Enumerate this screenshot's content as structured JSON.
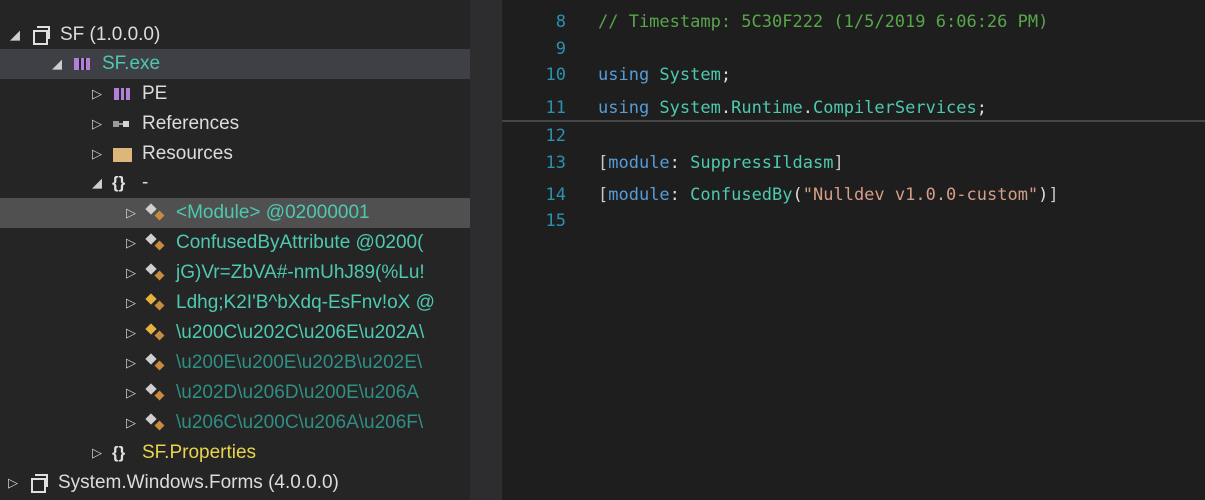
{
  "tree": {
    "nodes": [
      {
        "arrow": "◢",
        "icon": "assembly-icon",
        "label": "SF (1.0.0.0)"
      },
      {
        "arrow": "◢",
        "icon": "exe-icon",
        "label": "SF.exe"
      },
      {
        "arrow": "▷",
        "icon": "exe-icon",
        "label": "PE"
      },
      {
        "arrow": "▷",
        "icon": "references-icon",
        "label": "References"
      },
      {
        "arrow": "▷",
        "icon": "folder-icon",
        "label": "Resources"
      },
      {
        "arrow": "◢",
        "icon": "namespace-icon",
        "label": "-"
      },
      {
        "arrow": "▷",
        "icon": "type-icon",
        "label": "<Module> @02000001"
      },
      {
        "arrow": "▷",
        "icon": "type-icon",
        "label": "ConfusedByAttribute @0200("
      },
      {
        "arrow": "▷",
        "icon": "type-icon",
        "label": "jG)Vr=ZbVA#-nmUhJ89(%Lu!"
      },
      {
        "arrow": "▷",
        "icon": "type-icon",
        "label": "Ldhg;K2I'B^bXdq-EsFnv!oX @"
      },
      {
        "arrow": "▷",
        "icon": "type-icon",
        "label": "\\u200C\\u202C\\u206E\\u202A\\"
      },
      {
        "arrow": "▷",
        "icon": "type-icon",
        "label": "\\u200E\\u200E\\u202B\\u202E\\"
      },
      {
        "arrow": "▷",
        "icon": "type-icon",
        "label": "\\u202D\\u206D\\u200E\\u206A"
      },
      {
        "arrow": "▷",
        "icon": "type-icon",
        "label": "\\u206C\\u200C\\u206A\\u206F\\"
      },
      {
        "arrow": "▷",
        "icon": "namespace-icon",
        "label": "SF.Properties"
      },
      {
        "arrow": "▷",
        "icon": "assembly-icon",
        "label": "System.Windows.Forms (4.0.0.0)"
      }
    ]
  },
  "code": {
    "lines": [
      {
        "num": "8",
        "segments": [
          {
            "cls": "cm",
            "text": "// Timestamp: 5C30F222 (1/5/2019 6:06:26 PM)"
          }
        ]
      },
      {
        "num": "9",
        "segments": []
      },
      {
        "num": "10",
        "segments": [
          {
            "cls": "kw",
            "text": "using "
          },
          {
            "cls": "ty",
            "text": "System"
          },
          {
            "cls": "tx",
            "text": ";"
          }
        ]
      },
      {
        "num": "11",
        "segments": [
          {
            "cls": "kw",
            "text": "using "
          },
          {
            "cls": "ty",
            "text": "System"
          },
          {
            "cls": "tx",
            "text": "."
          },
          {
            "cls": "ty",
            "text": "Runtime"
          },
          {
            "cls": "tx",
            "text": "."
          },
          {
            "cls": "ty",
            "text": "CompilerServices"
          },
          {
            "cls": "tx",
            "text": ";"
          }
        ]
      },
      {
        "num": "12",
        "segments": []
      },
      {
        "num": "13",
        "segments": [
          {
            "cls": "ps",
            "text": "["
          },
          {
            "cls": "kw",
            "text": "module"
          },
          {
            "cls": "tx",
            "text": ": "
          },
          {
            "cls": "ty",
            "text": "SuppressIldasm"
          },
          {
            "cls": "ps",
            "text": "]"
          }
        ]
      },
      {
        "num": "14",
        "segments": [
          {
            "cls": "ps",
            "text": "["
          },
          {
            "cls": "kw",
            "text": "module"
          },
          {
            "cls": "tx",
            "text": ": "
          },
          {
            "cls": "ty",
            "text": "ConfusedBy"
          },
          {
            "cls": "tx",
            "text": "("
          },
          {
            "cls": "st",
            "text": "\"Nulldev v1.0.0-custom\""
          },
          {
            "cls": "tx",
            "text": ")"
          },
          {
            "cls": "ps",
            "text": "]"
          }
        ]
      },
      {
        "num": "15",
        "segments": []
      }
    ]
  }
}
